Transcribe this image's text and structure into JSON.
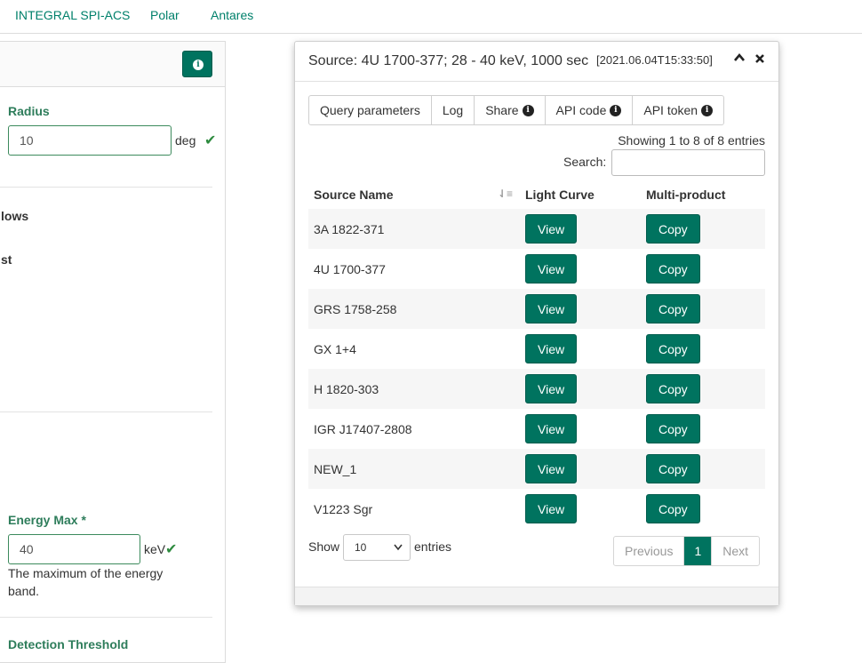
{
  "top_nav": {
    "items": [
      "INTEGRAL SPI-ACS",
      "Polar",
      "Antares"
    ]
  },
  "left_panel": {
    "radius_label": "Radius",
    "radius_value": "10",
    "radius_unit": "deg",
    "partial_label_1": "lows",
    "partial_label_2": "st",
    "energy_max_label": "Energy Max *",
    "energy_max_value": "40",
    "energy_max_unit": "keV",
    "energy_max_help": "The maximum of the energy band.",
    "partial_label_3": "Detection Threshold"
  },
  "dialog": {
    "title": "Source: 4U 1700-377; 28 - 40 keV, 1000 sec",
    "timestamp": "[2021.06.04T15:33:50]",
    "tabs": [
      "Query parameters",
      "Log",
      "Share",
      "API code",
      "API token"
    ],
    "showing_text": "Showing 1 to 8 of 8 entries",
    "search_label": "Search:",
    "search_value": "",
    "columns": [
      "Source Name",
      "Light Curve",
      "Multi-product"
    ],
    "rows": [
      {
        "name": "3A 1822-371",
        "view": "View",
        "copy": "Copy"
      },
      {
        "name": "4U 1700-377",
        "view": "View",
        "copy": "Copy"
      },
      {
        "name": "GRS 1758-258",
        "view": "View",
        "copy": "Copy"
      },
      {
        "name": "GX 1+4",
        "view": "View",
        "copy": "Copy"
      },
      {
        "name": "H 1820-303",
        "view": "View",
        "copy": "Copy"
      },
      {
        "name": "IGR J17407-2808",
        "view": "View",
        "copy": "Copy"
      },
      {
        "name": "NEW_1",
        "view": "View",
        "copy": "Copy"
      },
      {
        "name": "V1223 Sgr",
        "view": "View",
        "copy": "Copy"
      }
    ],
    "show_label": "Show",
    "show_selected": "10",
    "entries_label": "entries",
    "pagination": {
      "previous": "Previous",
      "current": "1",
      "next": "Next"
    }
  },
  "colors": {
    "accent": "#00735f",
    "label_green": "#2e7d5b",
    "check_green": "#2e8b3f"
  }
}
